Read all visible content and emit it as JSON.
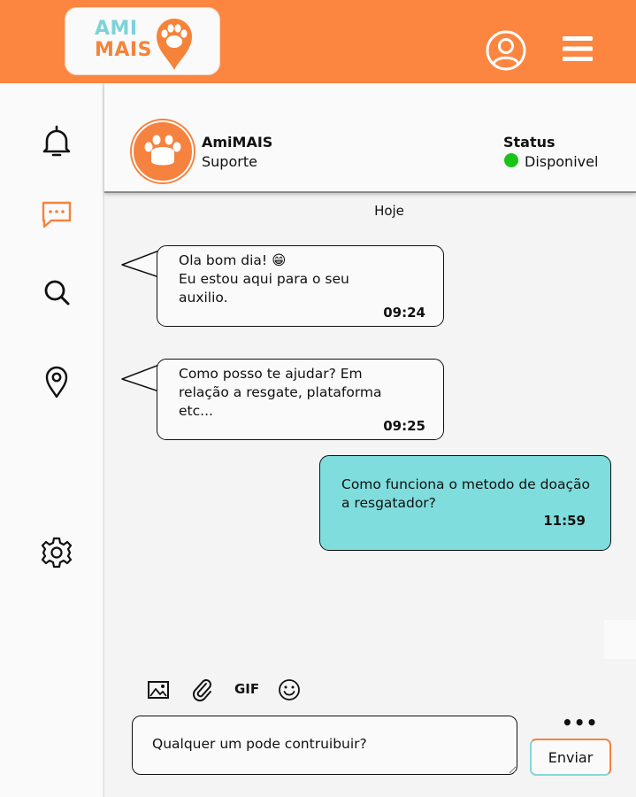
{
  "brand": {
    "logo_line1": "AMI",
    "logo_line2": "MAIS",
    "color_primary": "#fc8540",
    "color_accent": "#80dddd"
  },
  "header": {
    "user_icon": "user-account-icon",
    "menu_icon": "hamburger-menu-icon"
  },
  "sidebar": {
    "items": [
      {
        "icon": "bell-icon",
        "active": false
      },
      {
        "icon": "chat-icon",
        "active": true
      },
      {
        "icon": "search-icon",
        "active": false
      },
      {
        "icon": "location-pin-icon",
        "active": false
      },
      {
        "icon": "gear-icon",
        "active": false
      }
    ]
  },
  "chat": {
    "contact_name": "AmiMAIS",
    "contact_role": "Suporte",
    "status_label": "Status",
    "status_value": "Disponivel",
    "status_color": "#18c418",
    "date_label": "Hoje",
    "messages": [
      {
        "direction": "in",
        "text": "Ola bom dia! 😁\nEu estou aqui para o seu\nauxilio.",
        "time": "09:24"
      },
      {
        "direction": "in",
        "text": "Como posso te ajudar? Em\nrelação a resgate, plataforma\netc...",
        "time": "09:25"
      },
      {
        "direction": "out",
        "text": "Como funciona o metodo de doação\na resgatador?",
        "time": "11:59"
      }
    ]
  },
  "composer": {
    "gif_label": "GIF",
    "more_label": "•••",
    "input_value": "Qualquer um pode contruibuir?",
    "send_label": "Enviar",
    "tool_icons": [
      "image-icon",
      "paperclip-icon",
      "gif-icon",
      "emoji-icon"
    ]
  }
}
